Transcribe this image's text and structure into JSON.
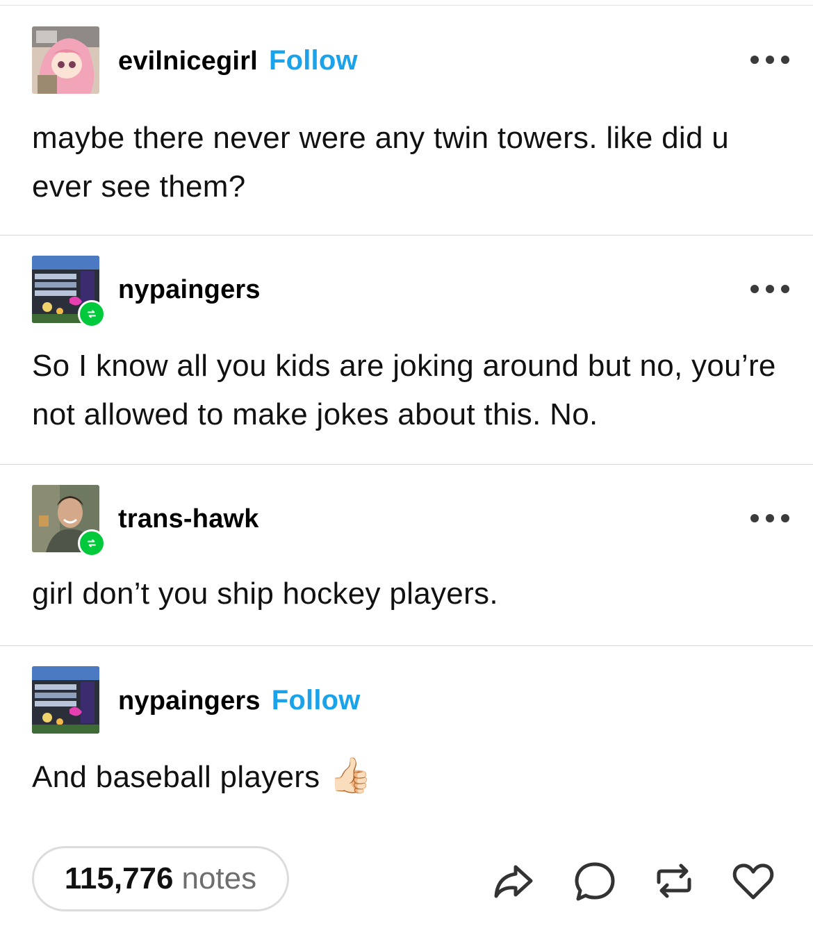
{
  "posts": [
    {
      "username": "evilnicegirl",
      "follow_label": "Follow",
      "text": "maybe there never were any twin towers. like did u ever see them?",
      "avatar_icon": "anime-girl-avatar",
      "more_icon": "more-dots-icon"
    },
    {
      "username": "nypaingers",
      "text": "So I know all you kids are joking around but no, you’re not allowed to make jokes about this. No.",
      "avatar_icon": "stadium-avatar",
      "badge_icon": "reblog-badge-icon",
      "more_icon": "more-dots-icon"
    },
    {
      "username": "trans-hawk",
      "text": "girl don’t you ship hockey players.",
      "avatar_icon": "man-photo-avatar",
      "badge_icon": "reblog-badge-icon",
      "more_icon": "more-dots-icon"
    },
    {
      "username": "nypaingers",
      "follow_label": "Follow",
      "text": "And baseball players",
      "emoji": "👍🏻",
      "avatar_icon": "stadium-avatar"
    }
  ],
  "footer": {
    "notes_count": "115,776",
    "notes_label": "notes",
    "actions": [
      "share-icon",
      "reply-icon",
      "reblog-icon",
      "like-icon"
    ]
  },
  "colors": {
    "follow": "#1aa3ea",
    "reblog_badge": "#00c93b",
    "divider": "#d6d6d6"
  }
}
